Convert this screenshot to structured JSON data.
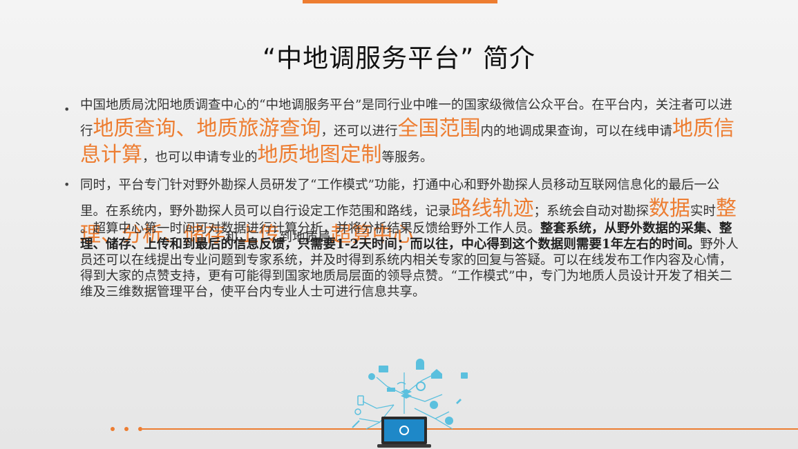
{
  "title": "“中地调服务平台” 简介",
  "bullet1": {
    "t1": "中国地质局沈阳地质调查中心的“中地调服务平台”是同行业中唯一的国家级微信公众平台。在平台内，关注者可以进行",
    "h1": "地质查询、地质旅游查询",
    "t2": "，还可以进行",
    "h2": "全国范围",
    "t3": "内的地调成果查询，可以在线申请",
    "h3": "地质信息计算",
    "t4": "，也可以申请专业的",
    "h4": "地质地图定制",
    "t5": "等服务。"
  },
  "bullet2": {
    "t1": "同时，平台专门针对野外勘探人员研发了“工作模式”功能，打通中心和野外勘探人员移动互联网信息化的最后一公里。在系统内，野外勘探人员可以自行设定工作范围和路线，记录",
    "h1": "路线轨迹",
    "t2": "；系统会自动对勘探",
    "h2": "数据",
    "t3": "实时",
    "h3": "整理、分析、储存",
    "t4": "和",
    "h4": "上传",
    "t5": "到地质局",
    "h5": "超算中心",
    "t6": "。超算中心第一时间可对数据进行计算分析，并将分析结果反馈给野外工作人员。",
    "b1": "整套系统，从野外数据的采集、整理、储存、上传和到最后的信息反馈，只需要1-2天时间；而以往，中心得到这个数据则需要1年左右的时间。",
    "t7": "野外人员还可以在线提出专业问题到专家系统，并及时得到系统内相关专家的回复与答疑。可以在线发布工作内容及心情，得到大家的点赞支持，更有可能得到国家地质局层面的领导点赞。“工作模式”中，专门为地质人员设计开发了相关二维及三维数据管理平台，使平台内专业人士可进行信息共享。"
  },
  "colors": {
    "accent": "#ed7d31",
    "icon": "#5bc0de",
    "laptop": "#1e88c8"
  }
}
